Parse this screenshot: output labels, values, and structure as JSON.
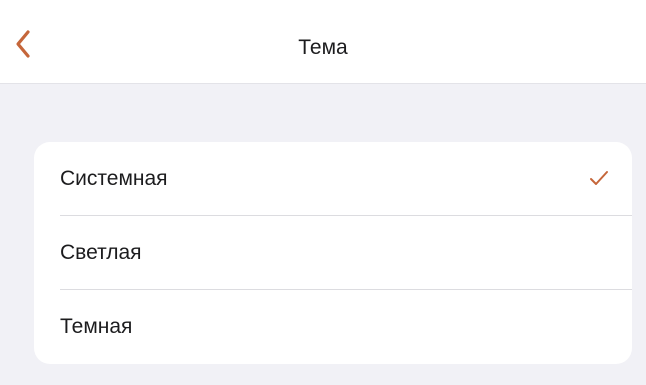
{
  "header": {
    "title": "Тема",
    "back_icon": "chevron-left-icon"
  },
  "colors": {
    "accent": "#c5663a",
    "background": "#f1f1f6",
    "card": "#ffffff",
    "text": "#1c1c1e"
  },
  "theme_options": [
    {
      "label": "Системная",
      "selected": true
    },
    {
      "label": "Светлая",
      "selected": false
    },
    {
      "label": "Темная",
      "selected": false
    }
  ],
  "checkmark_icon": "checkmark-icon"
}
